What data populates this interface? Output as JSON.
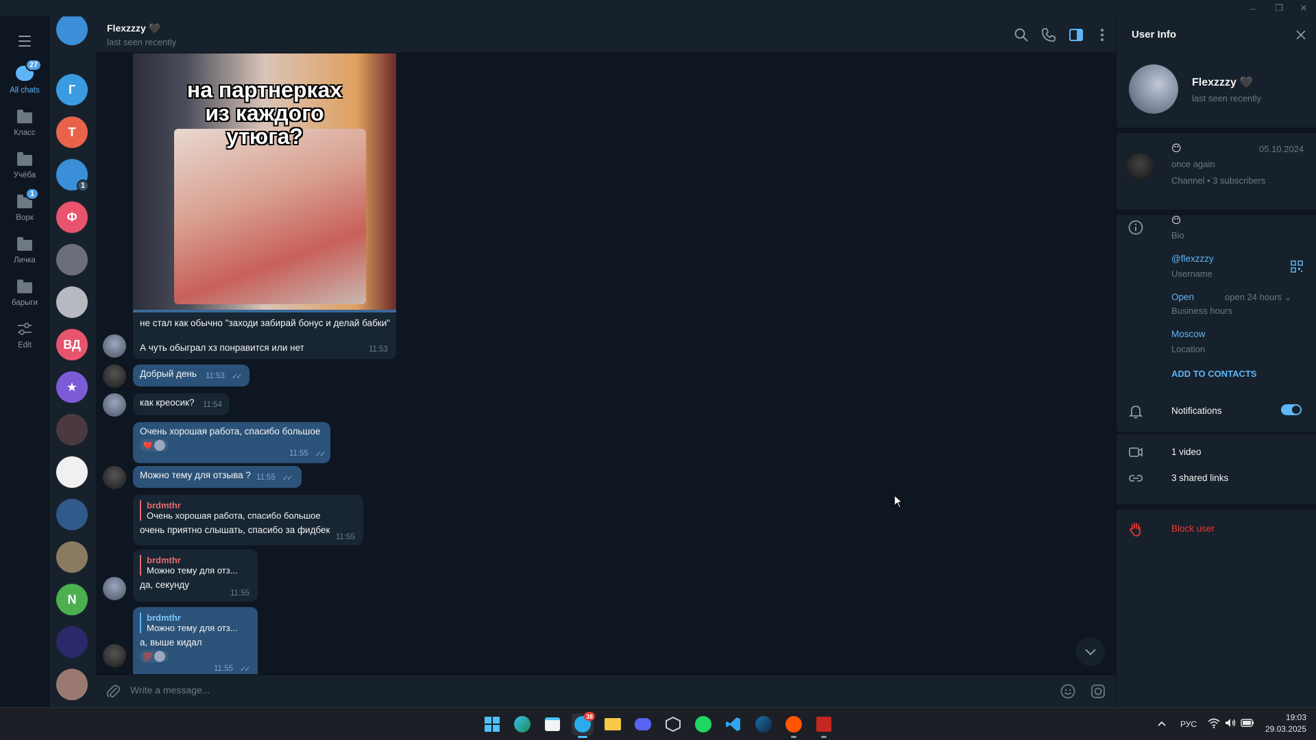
{
  "window": {
    "minimize": "–",
    "maximize": "❐",
    "close": "✕"
  },
  "folders": [
    {
      "label": "All chats",
      "badge": "27",
      "active": true
    },
    {
      "label": "Класс"
    },
    {
      "label": "Учёба"
    },
    {
      "label": "Ворк",
      "badge": "1"
    },
    {
      "label": "Личка"
    },
    {
      "label": "барыги"
    },
    {
      "label": "Edit"
    }
  ],
  "chat_list": {
    "avatars": [
      {
        "letter": "",
        "color": "#3a8fd8"
      },
      {
        "letter": "Г",
        "color": "#3a9be0"
      },
      {
        "letter": "Т",
        "color": "#e8634a"
      },
      {
        "letter": "",
        "color": "#3a8fd8",
        "badge": "1"
      },
      {
        "letter": "Ф",
        "color": "#e8536e"
      },
      {
        "letter": "",
        "color": "#6b6f7a"
      },
      {
        "letter": "",
        "color": "#b7b9c0"
      },
      {
        "letter": "ВД",
        "color": "#e8536e"
      },
      {
        "letter": "★",
        "color": "#7c5cd6"
      },
      {
        "letter": "",
        "color": "#4a3a40"
      },
      {
        "letter": "",
        "color": "#f0f0f0"
      },
      {
        "letter": "",
        "color": "#2f5a8a"
      },
      {
        "letter": "",
        "color": "#8a7a60"
      },
      {
        "letter": "N",
        "color": "#4caf50"
      },
      {
        "letter": "",
        "color": "#2a2a6a"
      },
      {
        "letter": "",
        "color": "#9a7a70"
      }
    ]
  },
  "header": {
    "name": "Flexzzzy 🖤",
    "status": "last seen recently"
  },
  "media": {
    "caption_line1": "на партнерках",
    "caption_line2": "из каждого",
    "caption_line3": "утюга?"
  },
  "messages": [
    {
      "id": "m1",
      "line1": "не стал как обычно \"заходи забирай бонус и делай бабки\"",
      "line2": "А чуть обыграл хз понравится или нет",
      "time": "11:53"
    },
    {
      "id": "m2",
      "text": "Добрый день",
      "time": "11:53",
      "ticks": "✓✓"
    },
    {
      "id": "m3",
      "text": "как креосик?",
      "time": "11:54"
    },
    {
      "id": "m4",
      "text": "Очень хорошая работа, спасибо большое",
      "reaction": "❤️",
      "time": "11:55",
      "ticks": "✓✓"
    },
    {
      "id": "m5",
      "text": "Можно тему для отзыва ?",
      "time": "11:55",
      "ticks": "✓✓"
    },
    {
      "id": "m6",
      "reply_name": "brdmthr",
      "reply_text": "Очень хорошая работа, спасибо большое",
      "text": "очень приятно слышать, спасибо за фидбек",
      "time": "11:55"
    },
    {
      "id": "m7",
      "reply_name": "brdmthr",
      "reply_text": "Можно тему для отз...",
      "text": "да, секунду",
      "time": "11:55"
    },
    {
      "id": "m8",
      "reply_name": "brdmthr",
      "reply_text": "Можно тему для отз...",
      "text": "а, выше кидал",
      "reaction": "💯",
      "time": "11:55",
      "ticks": "✓✓"
    }
  ],
  "composer": {
    "placeholder": "Write a message..."
  },
  "panel": {
    "title": "User Info",
    "name": "Flexzzzy 🖤",
    "status": "last seen recently",
    "channel": {
      "emoji": "😶",
      "date": "05.10.2024",
      "title": "once again",
      "meta": "Channel • 3 subscribers"
    },
    "bio": {
      "value": "😶",
      "label": "Bio"
    },
    "username": {
      "value": "@flexzzzy",
      "label": "Username"
    },
    "hours": {
      "value": "Open",
      "extra": "open 24 hours ⌄",
      "label": "Business hours"
    },
    "location": {
      "value": "Moscow",
      "label": "Location"
    },
    "add_contact": "ADD TO CONTACTS",
    "notifications": "Notifications",
    "notifications_on": true,
    "videos": "1 video",
    "links": "3 shared links",
    "block": "Block user"
  },
  "taskbar": {
    "telegram_badge": "38",
    "lang": "РУС",
    "time": "19:03",
    "date": "29.03.2025"
  },
  "colors": {
    "accent": "#5eb5f7",
    "outgoing": "#2b5278",
    "incoming": "#182533",
    "danger": "#e53935"
  }
}
